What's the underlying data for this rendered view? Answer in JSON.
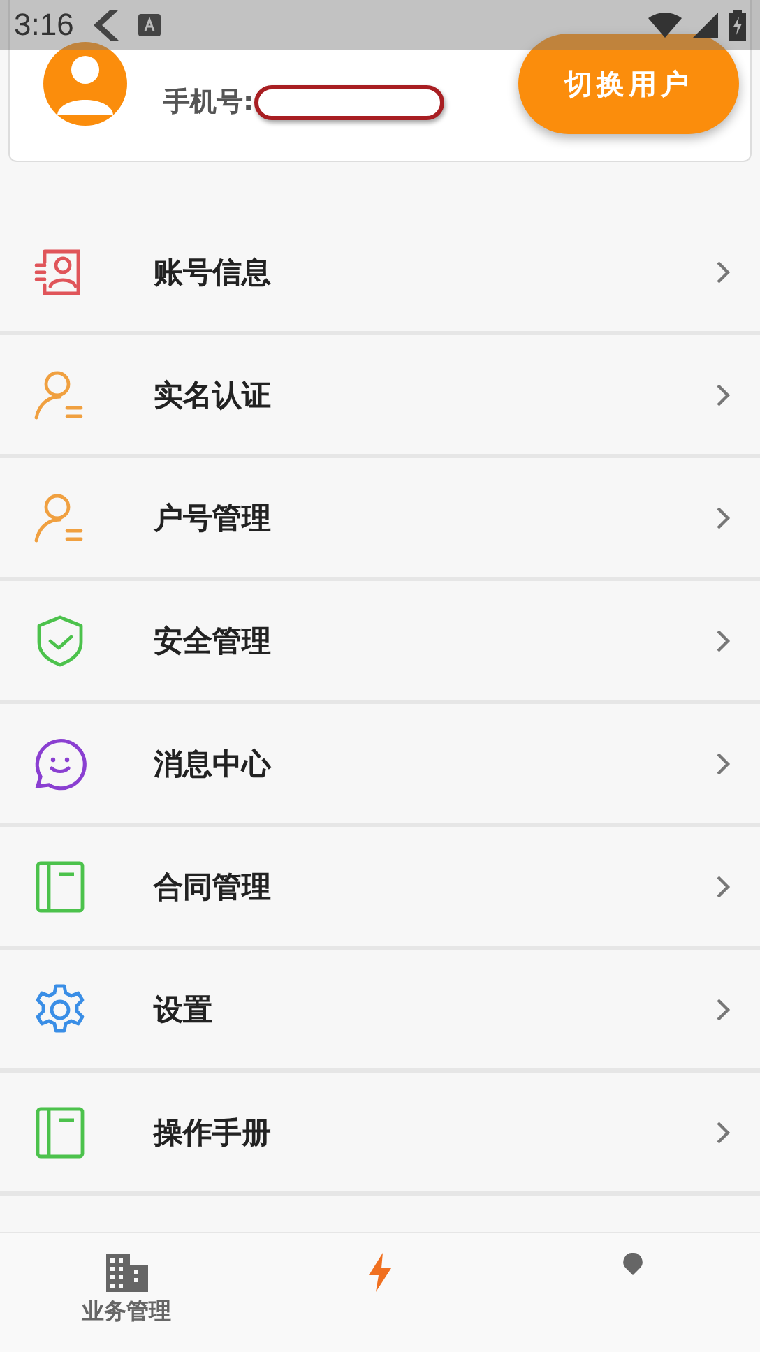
{
  "status_bar": {
    "time": "3:16"
  },
  "profile": {
    "phone_label": "手机号:",
    "switch_button": "切换用户"
  },
  "menu": [
    {
      "label": "账号信息",
      "kind": "card",
      "color": "#e0555a"
    },
    {
      "label": "实名认证",
      "kind": "user",
      "color": "#f0a040"
    },
    {
      "label": "户号管理",
      "kind": "user",
      "color": "#f0a040"
    },
    {
      "label": "安全管理",
      "kind": "shield",
      "color": "#4cc24c"
    },
    {
      "label": "消息中心",
      "kind": "chat",
      "color": "#8a3fd1"
    },
    {
      "label": "合同管理",
      "kind": "book",
      "color": "#4cc24c"
    },
    {
      "label": "设置",
      "kind": "gear",
      "color": "#3a8ee6"
    },
    {
      "label": "操作手册",
      "kind": "book",
      "color": "#4cc24c"
    }
  ],
  "bottom_nav": [
    {
      "label": "业务管理",
      "kind": "building",
      "selected": false
    },
    {
      "kind": "bolt",
      "selected": true
    },
    {
      "kind": "dot",
      "selected": false
    }
  ]
}
